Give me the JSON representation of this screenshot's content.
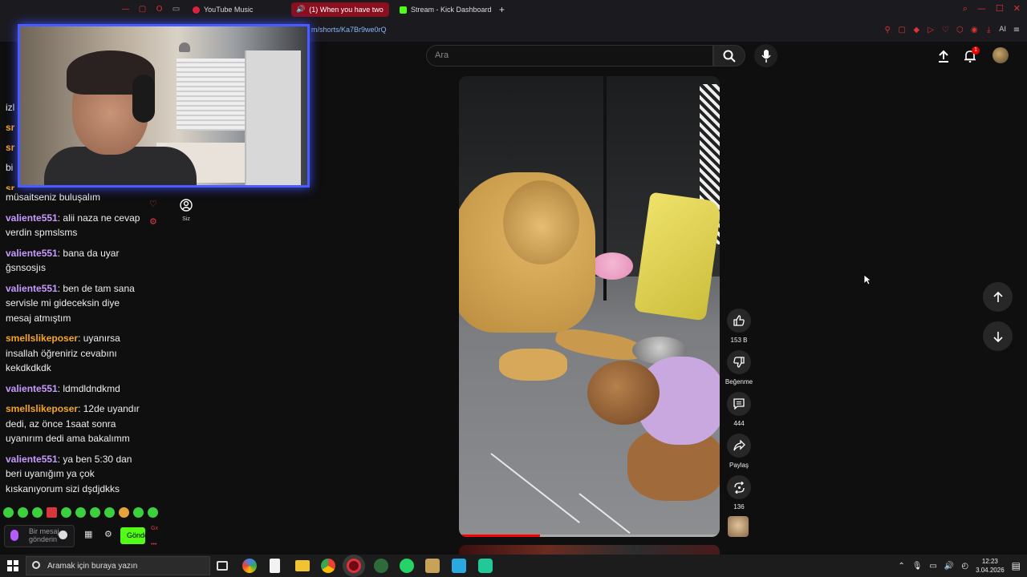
{
  "browser": {
    "tabs": [
      {
        "label": "YouTube Music",
        "active": false
      },
      {
        "label": "(1) When you have two",
        "active": true
      },
      {
        "label": "Stream - Kick Dashboard",
        "active": false
      }
    ],
    "new_tab": "+",
    "url": "m/shorts/Ka7Br9we0rQ",
    "ai_label": "AI"
  },
  "youtube": {
    "search_placeholder": "Ara",
    "notification_count": "1",
    "rail_you_label": "Siz",
    "actions": {
      "like_count": "153 B",
      "dislike_label": "Beğenme",
      "comment_count": "444",
      "share_label": "Paylaş",
      "remix_count": "136"
    },
    "video_progress": 0.31
  },
  "chat": {
    "top_partial": [
      {
        "text": "izl"
      },
      {
        "user": "sr",
        "text": ""
      },
      {
        "user": "sr",
        "text": ""
      },
      {
        "text": "bi"
      },
      {
        "user": "sr",
        "text": ""
      }
    ],
    "messages": [
      {
        "user": "",
        "text": "müsaitseniz buluşalım",
        "color": "none"
      },
      {
        "user": "valiente551",
        "text": "alii naza ne cevap verdin spmslsms",
        "color": "purple"
      },
      {
        "user": "valiente551",
        "text": "bana da uyar ğsnsosjıs",
        "color": "purple"
      },
      {
        "user": "valiente551",
        "text": "ben de tam sana servisle mi gideceksin diye mesaj atmıştım",
        "color": "purple"
      },
      {
        "user": "smellslikeposer",
        "text": "uyanırsa insallah öğreniriz cevabını kekdkdkdk",
        "color": "orange"
      },
      {
        "user": "valiente551",
        "text": "ldmdldndkmd",
        "color": "purple"
      },
      {
        "user": "smellslikeposer",
        "text": "12de uyandır dedi, az önce 1saat sonra uyanırım dedi ama bakalımm",
        "color": "orange"
      },
      {
        "user": "valiente551",
        "text": "ya ben 5:30 dan beri uyanığım ya çok kıskanıyorum sizi dşdjdkks",
        "color": "purple"
      }
    ],
    "input_placeholder": "Bir mesaj gönderin",
    "send_label": "Gönder",
    "mini_label": "Gx"
  },
  "taskbar": {
    "search_placeholder": "Aramak için buraya yazın",
    "time": "12:23",
    "date": "3.04.2026"
  },
  "colors": {
    "user_purple": "#c89cff",
    "user_orange": "#f5a623",
    "kick_green": "#53fc18",
    "cam_border": "#4a5cff"
  }
}
